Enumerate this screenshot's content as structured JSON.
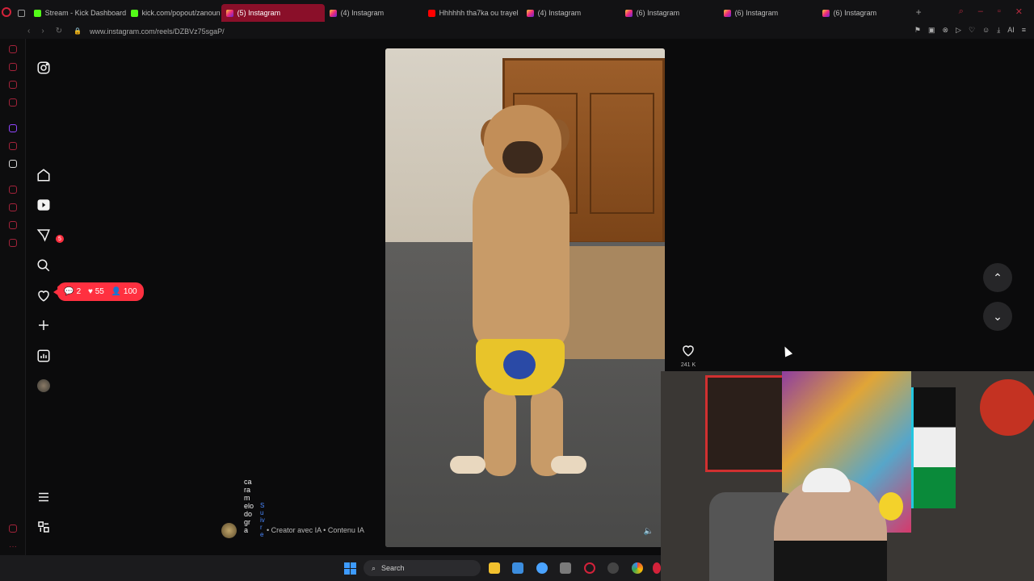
{
  "tabs": [
    {
      "label": "",
      "fav": "doc",
      "active": false
    },
    {
      "label": "Stream - Kick Dashboard",
      "fav": "kick",
      "active": false
    },
    {
      "label": "kick.com/popout/zanoun",
      "fav": "kick",
      "active": false
    },
    {
      "label": "(5) Instagram",
      "fav": "insta",
      "active": true
    },
    {
      "label": "(4) Instagram",
      "fav": "insta",
      "active": false
    },
    {
      "label": "Hhhhhh tha7ka ou trayel",
      "fav": "yt",
      "active": false
    },
    {
      "label": "(4) Instagram",
      "fav": "insta",
      "active": false
    },
    {
      "label": "(6) Instagram",
      "fav": "insta",
      "active": false
    },
    {
      "label": "(6) Instagram",
      "fav": "insta",
      "active": false
    },
    {
      "label": "(6) Instagram",
      "fav": "insta",
      "active": false
    }
  ],
  "address": {
    "url": "www.instagram.com/reels/DZBVz75sgaP/"
  },
  "addr_tools_ai": "AI",
  "nav": {
    "messages_badge": "5"
  },
  "activity": {
    "comments": "2",
    "likes": "55",
    "followers": "100"
  },
  "reel": {
    "like_count": "241 K",
    "author_username": "caramelodogra",
    "follow_label": "Suivre",
    "meta": "• Creator avec IA • Contenu IA"
  },
  "taskbar": {
    "search_placeholder": "Search"
  },
  "colors": {
    "accent": "#ff3040",
    "active_tab": "#8a0f29",
    "link": "#4a88ff"
  }
}
